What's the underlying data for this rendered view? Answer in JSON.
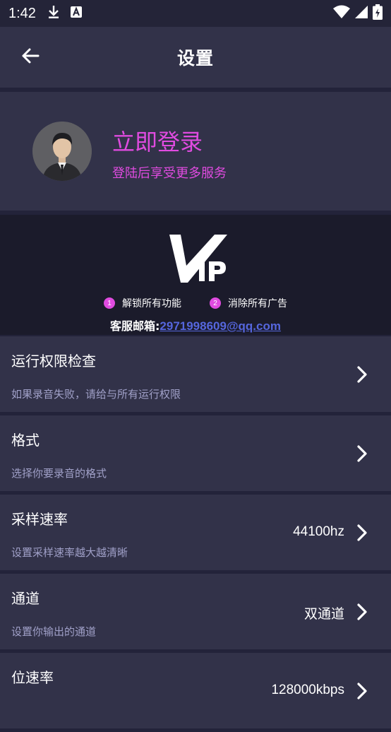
{
  "status_bar": {
    "time": "1:42",
    "icons": [
      "download-icon",
      "accessibility-a-icon",
      "wifi-icon",
      "signal-icon",
      "battery-icon"
    ]
  },
  "app_bar": {
    "title": "设置",
    "back_icon": "arrow-left-icon"
  },
  "login": {
    "title": "立即登录",
    "subtitle": "登陆后享受更多服务",
    "avatar_icon": "user-avatar",
    "accent_color": "#e04be0"
  },
  "vip": {
    "logo_letters": "VIP",
    "features": [
      {
        "num": "1",
        "label": "解锁所有功能"
      },
      {
        "num": "2",
        "label": "消除所有广告"
      }
    ],
    "contact_label": "客服邮箱:",
    "contact_email": "2971998609@qq.com"
  },
  "settings": [
    {
      "title": "运行权限检查",
      "desc": "如果录音失败，请给与所有运行权限",
      "value": ""
    },
    {
      "title": "格式",
      "desc": "选择你要录音的格式",
      "value": ""
    },
    {
      "title": "采样速率",
      "desc": "设置采样速率越大越清晰",
      "value": "44100hz"
    },
    {
      "title": "通道",
      "desc": "设置你输出的通道",
      "value": "双通道"
    },
    {
      "title": "位速率",
      "desc": "",
      "value": "128000kbps"
    }
  ],
  "colors": {
    "background": "#23233a",
    "card": "#323249",
    "vip_bg": "#1b1b2b",
    "accent": "#e04be0",
    "link": "#5566dd",
    "desc_text": "#a0a0c8"
  }
}
